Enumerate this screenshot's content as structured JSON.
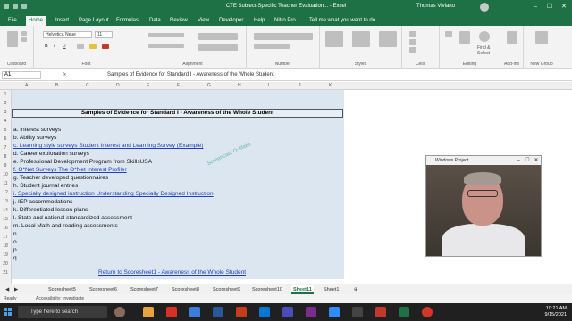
{
  "app": {
    "title": "CTE Subject-Specific Teacher Evaluation... - Excel",
    "user": "Thomas Viviano",
    "window_min": "–",
    "window_max": "☐",
    "window_close": "✕"
  },
  "ribbon_tabs": [
    "File",
    "Home",
    "Insert",
    "Page Layout",
    "Formulas",
    "Data",
    "Review",
    "View",
    "Developer",
    "Help",
    "Nitro Pro"
  ],
  "active_tab": "Home",
  "tell_me": "Tell me what you want to do",
  "ribbon": {
    "font_name": "Helvetica Neue",
    "font_size": "11",
    "groups": [
      "Clipboard",
      "Font",
      "Alignment",
      "Number",
      "Styles",
      "Cells",
      "Editing",
      "Add-ins",
      "New Group"
    ],
    "find_select": "Find & Select"
  },
  "formula_bar": {
    "name_box": "A1",
    "content": "Samples of Evidence for Standard I - Awareness of the Whole Student"
  },
  "columns": [
    "A",
    "B",
    "C",
    "D",
    "E",
    "F",
    "G",
    "H",
    "I",
    "J",
    "K"
  ],
  "rows": [
    "1",
    "2",
    "3",
    "4",
    "5",
    "6",
    "7",
    "8",
    "9",
    "10",
    "11",
    "12",
    "13",
    "14",
    "15",
    "16",
    "17",
    "18",
    "19",
    "20",
    "21"
  ],
  "sheet": {
    "header": "Samples of Evidence for Standard I - Awareness of the Whole Student",
    "items": [
      {
        "text": "a. Interest surveys",
        "link": false
      },
      {
        "text": "b. Ability surveys",
        "link": false
      },
      {
        "text": "c. Learning style surveys  Student Interest and Learning Survey (Example)",
        "link": true
      },
      {
        "text": "d. Career exploration surveys",
        "link": false
      },
      {
        "text": "e. Professional Development Program from SkillsUSA",
        "link": false
      },
      {
        "text": "f. O*Net Surveys   The O*Net Interest Profiler",
        "link": true
      },
      {
        "text": "g. Teacher developed questionnaires",
        "link": false
      },
      {
        "text": "h. Student journal entries",
        "link": false
      },
      {
        "text": "i. Specially designed instruction  Understanding Specially Designed Instruction",
        "link": true
      },
      {
        "text": "j. IEP accommodations",
        "link": false
      },
      {
        "text": "k. Differentiated lesson plans",
        "link": false
      },
      {
        "text": "l. State and national standardized assessment",
        "link": false
      },
      {
        "text": "m. Local Math and reading assessments",
        "link": false
      },
      {
        "text": "n.",
        "link": false
      },
      {
        "text": "o.",
        "link": false
      },
      {
        "text": "p.",
        "link": false
      },
      {
        "text": "q.",
        "link": false
      }
    ],
    "watermark": "Screencast-O-Matic",
    "return_link": "Return to Scoresheet1 - Awareness of the Whole Student"
  },
  "sheet_tabs": [
    "Scoresheet5",
    "Scoresheet6",
    "Scoresheet7",
    "Scoresheet8",
    "Scoresheet9",
    "Scoresheet10",
    "Sheet11",
    "Sheet1"
  ],
  "active_sheet": "Sheet11",
  "status": {
    "ready": "Ready",
    "accessibility": "Accessibility: Investigate"
  },
  "taskbar": {
    "search": "Type here to search",
    "time": "10:21 AM",
    "date": "9/15/2021"
  },
  "webcam": {
    "title": "Windows Project..."
  },
  "colors": {
    "excel_green": "#1e7145",
    "sheet_fill": "#dce6f1",
    "link": "#1f3fb5"
  }
}
